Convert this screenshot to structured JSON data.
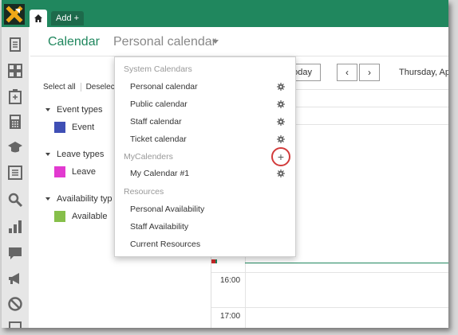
{
  "topbar": {
    "home_icon": "home-icon",
    "add_tab_label": "Add +"
  },
  "header": {
    "title": "Calendar",
    "calendar_selector": "Personal calendar"
  },
  "selection": {
    "select_all": "Select all",
    "deselect": "Deselect"
  },
  "groups": [
    {
      "label": "Event types",
      "items": [
        {
          "label": "Event",
          "color": "#3f4fb5"
        }
      ]
    },
    {
      "label": "Leave types",
      "items": [
        {
          "label": "Leave",
          "color": "#e23ad0"
        }
      ]
    },
    {
      "label": "Availability typ",
      "items": [
        {
          "label": "Available",
          "color": "#86bf4a"
        }
      ]
    }
  ],
  "toolbar": {
    "today_label": "oday",
    "prev": "‹",
    "next": "›",
    "date_label": "Thursday, Ap"
  },
  "time_labels": [
    "16:00",
    "17:00"
  ],
  "dropdown": {
    "system_header": "System Calendars",
    "system_items": [
      "Personal calendar",
      "Public calendar",
      "Staff calendar",
      "Ticket calendar"
    ],
    "my_header": "MyCalenders",
    "my_items": [
      "My Calendar #1"
    ],
    "resources_header": "Resources",
    "resource_items": [
      "Personal Availability",
      "Staff Availability",
      "Current Resources"
    ],
    "add_symbol": "+"
  },
  "colors": {
    "brand": "#20875e",
    "highlight": "#d23b3b"
  }
}
